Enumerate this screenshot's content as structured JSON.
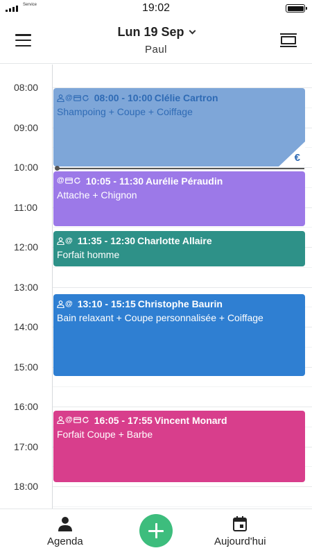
{
  "status_bar": {
    "carrier": "Service",
    "time": "19:02"
  },
  "header": {
    "date": "Lun 19 Sep",
    "staff": "Paul",
    "menu_icon": "hamburger-menu-icon",
    "view_icon": "day-view-icon",
    "dropdown_icon": "chevron-down-icon"
  },
  "calendar": {
    "hours": [
      "08:00",
      "09:00",
      "10:00",
      "11:00",
      "12:00",
      "13:00",
      "14:00",
      "15:00",
      "16:00",
      "17:00",
      "18:00"
    ],
    "events": [
      {
        "time": "08:00 - 10:00",
        "client": "Clélie Cartron",
        "service": "Shampoing + Coupe + Coiffage",
        "icons": [
          "person-icon",
          "at-icon",
          "card-icon",
          "repeat-icon"
        ],
        "color": "#7ea6d8",
        "text_color": "#2f6bb5",
        "paid_badge": "€"
      },
      {
        "time": "10:05 - 11:30",
        "client": "Aurélie Péraudin",
        "service": "Attache + Chignon",
        "icons": [
          "at-icon",
          "card-icon",
          "repeat-icon"
        ],
        "color": "#9c79e8"
      },
      {
        "time": "11:35 - 12:30",
        "client": "Charlotte Allaire",
        "service": "Forfait homme",
        "icons": [
          "person-icon",
          "at-icon"
        ],
        "color": "#2e9188"
      },
      {
        "time": "13:10 - 15:15",
        "client": "Christophe Baurin",
        "service": "Bain relaxant + Coupe personnalisée + Coiffage",
        "icons": [
          "person-icon",
          "at-icon"
        ],
        "color": "#2f7fd2"
      },
      {
        "time": "16:05 - 17:55",
        "client": "Vincent Monard",
        "service": "Forfait Coupe + Barbe",
        "icons": [
          "person-icon",
          "at-icon",
          "card-icon",
          "repeat-icon"
        ],
        "color": "#d83e8c"
      }
    ]
  },
  "bottom_nav": {
    "agenda_label": "Agenda",
    "today_label": "Aujourd'hui",
    "add_icon": "plus-icon",
    "accent": "#3dbd7d"
  }
}
